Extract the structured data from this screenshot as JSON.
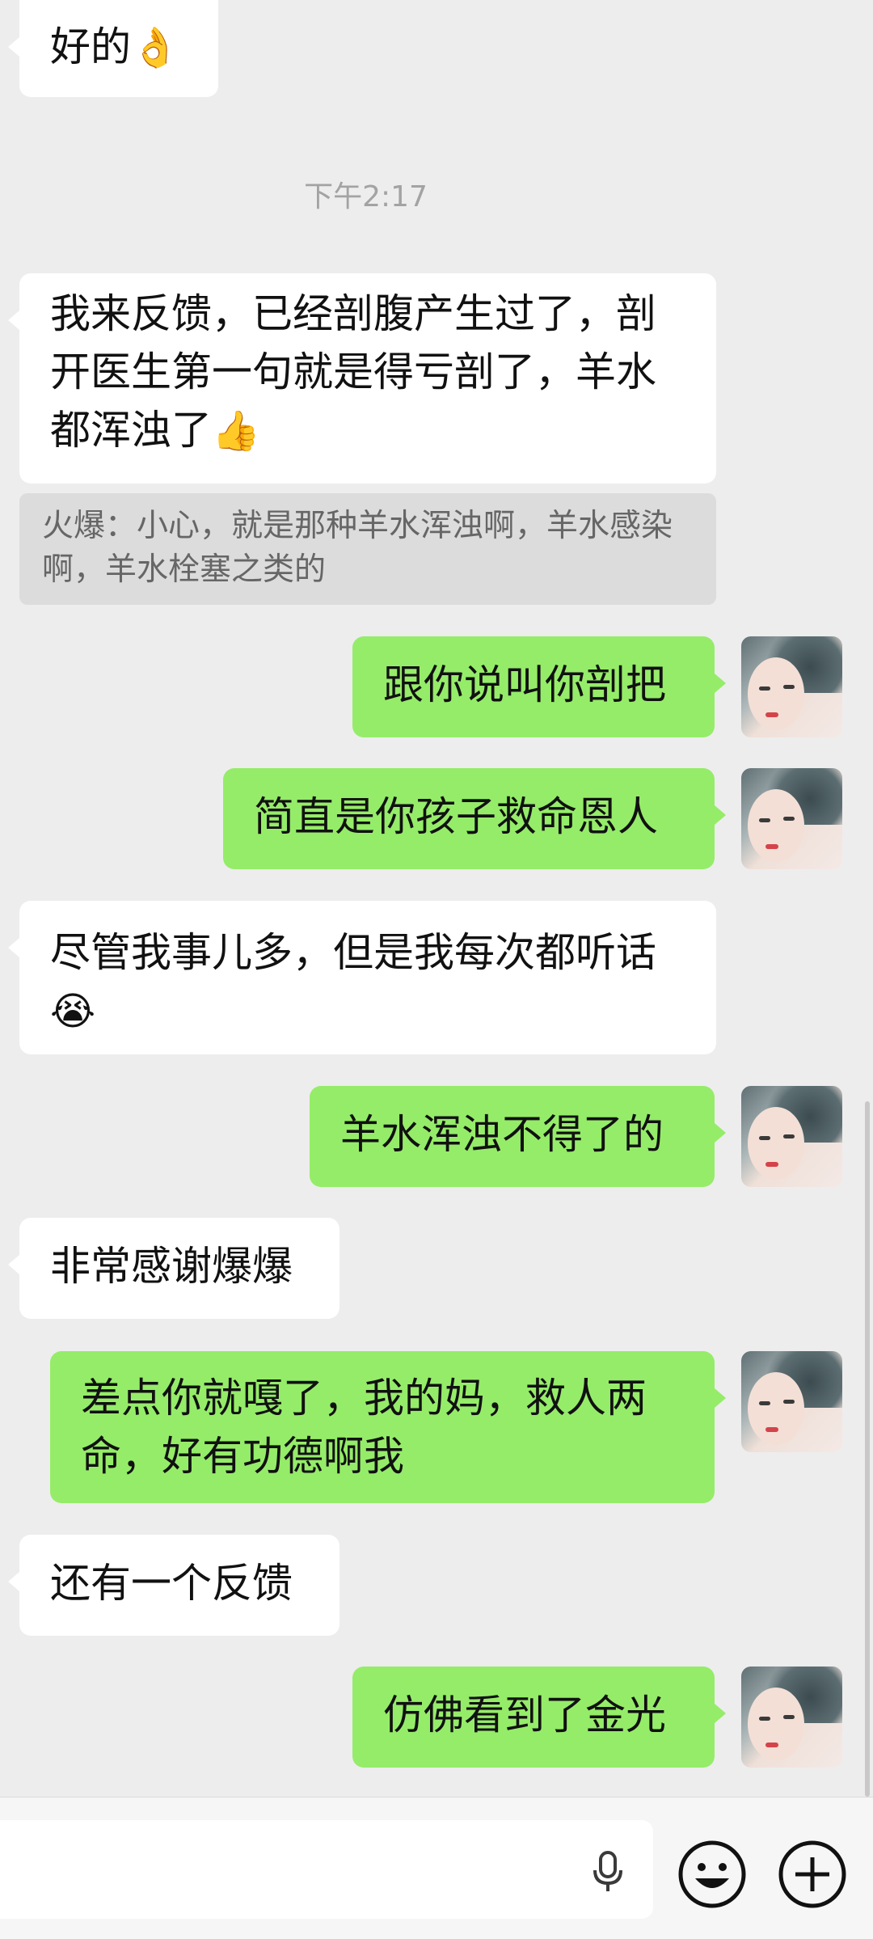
{
  "messages": [
    {
      "side": "in",
      "text": "好的",
      "emoji": "👌"
    },
    {
      "side": "in",
      "text": "我来反馈，已经剖腹产生过了，剖开医生第一句就是得亏剖了，羊水都浑浊了",
      "emoji": "👍"
    },
    {
      "side": "out",
      "text": "跟你说叫你剖把"
    },
    {
      "side": "out",
      "text": "简直是你孩子救命恩人"
    },
    {
      "side": "in",
      "text": "尽管我事儿多，但是我每次都听话",
      "emoji": "😭"
    },
    {
      "side": "out",
      "text": "羊水浑浊不得了的"
    },
    {
      "side": "in",
      "text": "非常感谢爆爆"
    },
    {
      "side": "out",
      "text": "差点你就嘎了，我的妈，救人两命，好有功德啊我"
    },
    {
      "side": "in",
      "text": "还有一个反馈"
    },
    {
      "side": "out",
      "text": "仿佛看到了金光"
    }
  ],
  "timestamp": "下午2:17",
  "quote": {
    "text": "火爆：小心，就是那种羊水浑浊啊，羊水感染啊，羊水栓塞之类的"
  },
  "input_bar": {
    "icons": [
      "microphone-icon",
      "emoji-icon",
      "plus-icon"
    ]
  },
  "colors": {
    "background": "#ededed",
    "incoming_bubble": "#ffffff",
    "outgoing_bubble": "#95ec69",
    "quote_background": "#dcdcdc"
  }
}
